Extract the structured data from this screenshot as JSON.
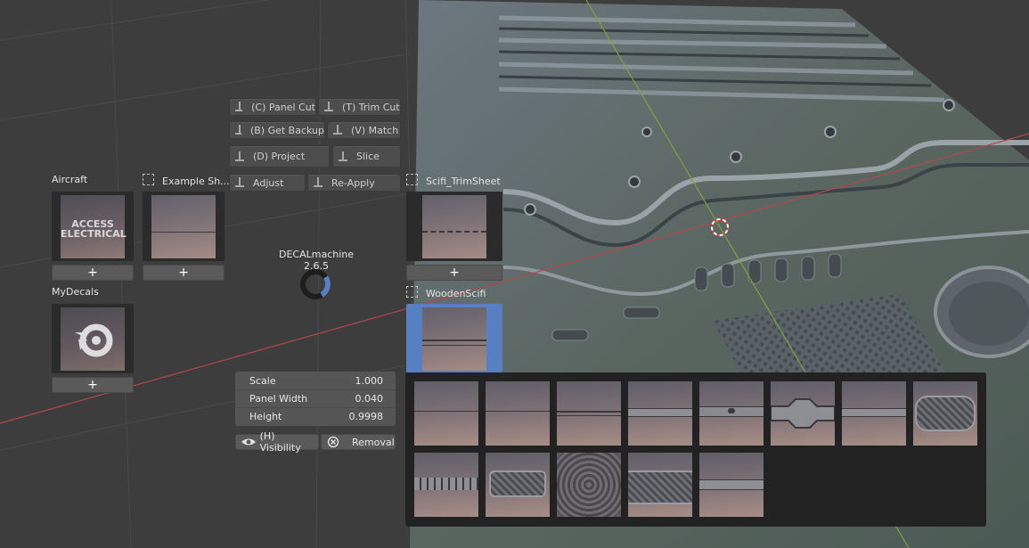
{
  "app": {
    "addon_name": "DECALmachine 2.6.5"
  },
  "pie_menu": [
    {
      "label": "(C) Panel Cut"
    },
    {
      "label": "(T) Trim Cut"
    },
    {
      "label": "(B) Get Backup"
    },
    {
      "label": "(V) Match"
    },
    {
      "label": "(D) Project"
    },
    {
      "label": "Slice"
    },
    {
      "label": "Adjust"
    },
    {
      "label": "Re-Apply"
    }
  ],
  "libraries": [
    {
      "name": "Aircraft",
      "thumb_text_line1": "ACCESS",
      "thumb_text_line2": "ELECTRICAL",
      "add_label": "+"
    },
    {
      "name": "Example Sh...",
      "add_label": "+"
    },
    {
      "name": "MyDecals",
      "add_label": "+"
    },
    {
      "name": "Scifi_TrimSheet",
      "add_label": "+"
    },
    {
      "name": "WoodenScifi"
    }
  ],
  "properties": [
    {
      "label": "Scale",
      "value": "1.000"
    },
    {
      "label": "Panel Width",
      "value": "0.040"
    },
    {
      "label": "Height",
      "value": "0.9998"
    }
  ],
  "toggles": {
    "visibility_label": "(H) Visibility",
    "removal_label": "Removal"
  },
  "decal_grid_count": 13,
  "colors": {
    "accent": "#5680c2",
    "selected_bg": "#5680c2",
    "x_axis": "#b3474f",
    "y_axis": "#7ea33b"
  }
}
